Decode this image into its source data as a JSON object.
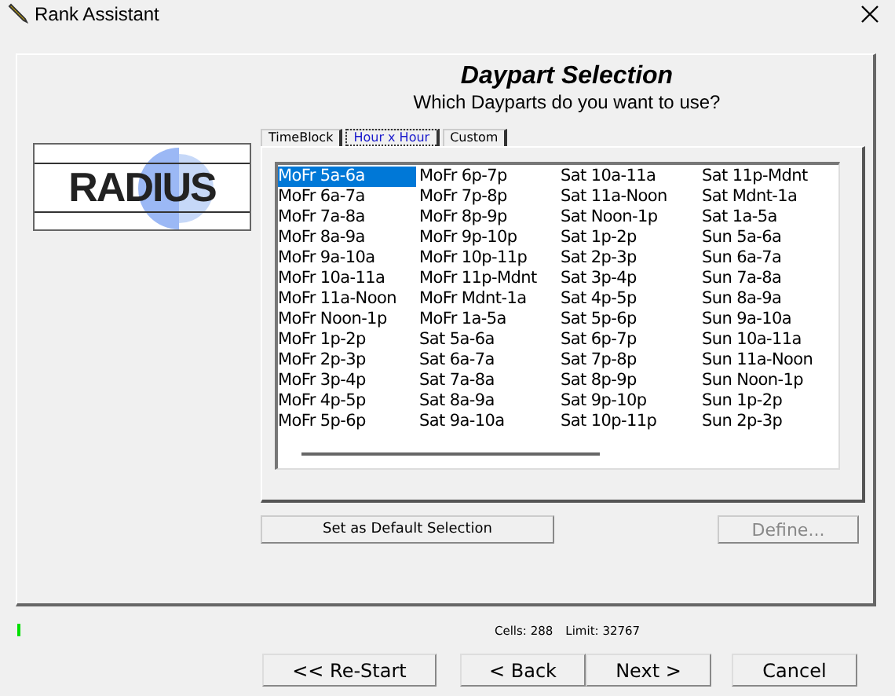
{
  "window": {
    "title": "Rank Assistant"
  },
  "heading": "Daypart Selection",
  "subtitle": "Which Dayparts do you want to use?",
  "logo": {
    "text": "RADIUS"
  },
  "tabs": [
    {
      "label": "TimeBlock",
      "selected": false
    },
    {
      "label": "Hour x Hour",
      "selected": true
    },
    {
      "label": "Custom",
      "selected": false
    }
  ],
  "dayparts": [
    {
      "label": "MoFr 5a-6a",
      "selected": true
    },
    {
      "label": "MoFr 6a-7a",
      "selected": false
    },
    {
      "label": "MoFr 7a-8a",
      "selected": false
    },
    {
      "label": "MoFr 8a-9a",
      "selected": false
    },
    {
      "label": "MoFr 9a-10a",
      "selected": false
    },
    {
      "label": "MoFr 10a-11a",
      "selected": false
    },
    {
      "label": "MoFr 11a-Noon",
      "selected": false
    },
    {
      "label": "MoFr Noon-1p",
      "selected": false
    },
    {
      "label": "MoFr 1p-2p",
      "selected": false
    },
    {
      "label": "MoFr 2p-3p",
      "selected": false
    },
    {
      "label": "MoFr 3p-4p",
      "selected": false
    },
    {
      "label": "MoFr 4p-5p",
      "selected": false
    },
    {
      "label": "MoFr 5p-6p",
      "selected": false
    },
    {
      "label": "MoFr 6p-7p",
      "selected": false
    },
    {
      "label": "MoFr 7p-8p",
      "selected": false
    },
    {
      "label": "MoFr 8p-9p",
      "selected": false
    },
    {
      "label": "MoFr 9p-10p",
      "selected": false
    },
    {
      "label": "MoFr 10p-11p",
      "selected": false
    },
    {
      "label": "MoFr 11p-Mdnt",
      "selected": false
    },
    {
      "label": "MoFr Mdnt-1a",
      "selected": false
    },
    {
      "label": "MoFr 1a-5a",
      "selected": false
    },
    {
      "label": "Sat 5a-6a",
      "selected": false
    },
    {
      "label": "Sat 6a-7a",
      "selected": false
    },
    {
      "label": "Sat 7a-8a",
      "selected": false
    },
    {
      "label": "Sat 8a-9a",
      "selected": false
    },
    {
      "label": "Sat 9a-10a",
      "selected": false
    },
    {
      "label": "Sat 10a-11a",
      "selected": false
    },
    {
      "label": "Sat 11a-Noon",
      "selected": false
    },
    {
      "label": "Sat Noon-1p",
      "selected": false
    },
    {
      "label": "Sat 1p-2p",
      "selected": false
    },
    {
      "label": "Sat 2p-3p",
      "selected": false
    },
    {
      "label": "Sat 3p-4p",
      "selected": false
    },
    {
      "label": "Sat 4p-5p",
      "selected": false
    },
    {
      "label": "Sat 5p-6p",
      "selected": false
    },
    {
      "label": "Sat 6p-7p",
      "selected": false
    },
    {
      "label": "Sat 7p-8p",
      "selected": false
    },
    {
      "label": "Sat 8p-9p",
      "selected": false
    },
    {
      "label": "Sat 9p-10p",
      "selected": false
    },
    {
      "label": "Sat 10p-11p",
      "selected": false
    },
    {
      "label": "Sat 11p-Mdnt",
      "selected": false
    },
    {
      "label": "Sat Mdnt-1a",
      "selected": false
    },
    {
      "label": "Sat 1a-5a",
      "selected": false
    },
    {
      "label": "Sun 5a-6a",
      "selected": false
    },
    {
      "label": "Sun 6a-7a",
      "selected": false
    },
    {
      "label": "Sun 7a-8a",
      "selected": false
    },
    {
      "label": "Sun 8a-9a",
      "selected": false
    },
    {
      "label": "Sun 9a-10a",
      "selected": false
    },
    {
      "label": "Sun 10a-11a",
      "selected": false
    },
    {
      "label": "Sun 11a-Noon",
      "selected": false
    },
    {
      "label": "Sun Noon-1p",
      "selected": false
    },
    {
      "label": "Sun 1p-2p",
      "selected": false
    },
    {
      "label": "Sun 2p-3p",
      "selected": false
    }
  ],
  "panel_buttons": [
    {
      "label": "Set as Default Selection",
      "disabled": false
    },
    {
      "label": "Define...",
      "disabled": true
    }
  ],
  "status": [
    {
      "label": "Cells:",
      "value": "288"
    },
    {
      "label": "Limit:",
      "value": "32767"
    }
  ],
  "nav_buttons": [
    "<< Re-Start",
    "< Back",
    "Next >",
    "Cancel"
  ]
}
